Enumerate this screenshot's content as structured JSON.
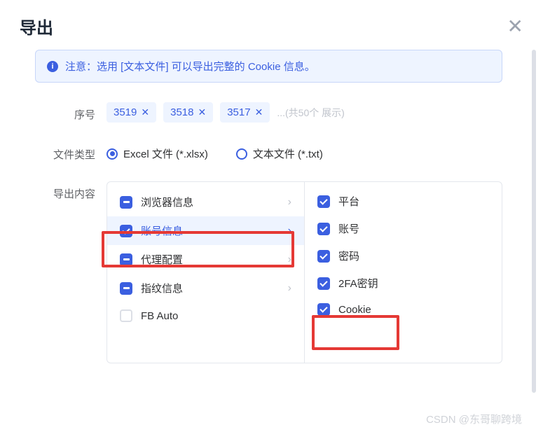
{
  "header": {
    "title": "导出"
  },
  "alert": {
    "text": "注意：选用 [文本文件] 可以导出完整的 Cookie 信息。"
  },
  "labels": {
    "serial": "序号",
    "filetype": "文件类型",
    "content": "导出内容"
  },
  "tags": {
    "items": [
      "3519",
      "3518",
      "3517"
    ],
    "more": "...(共50个 展示)"
  },
  "filetype": {
    "excel": "Excel 文件 (*.xlsx)",
    "txt": "文本文件 (*.txt)"
  },
  "categories": [
    {
      "label": "浏览器信息",
      "state": "indeterminate",
      "expandable": true
    },
    {
      "label": "账号信息",
      "state": "checked",
      "expandable": true,
      "active": true
    },
    {
      "label": "代理配置",
      "state": "indeterminate",
      "expandable": true
    },
    {
      "label": "指纹信息",
      "state": "indeterminate",
      "expandable": true
    },
    {
      "label": "FB Auto",
      "state": "empty",
      "expandable": false
    }
  ],
  "subitems": [
    {
      "label": "平台"
    },
    {
      "label": "账号"
    },
    {
      "label": "密码"
    },
    {
      "label": "2FA密钥"
    },
    {
      "label": "Cookie"
    }
  ],
  "watermark": "CSDN @东哥聊跨境"
}
